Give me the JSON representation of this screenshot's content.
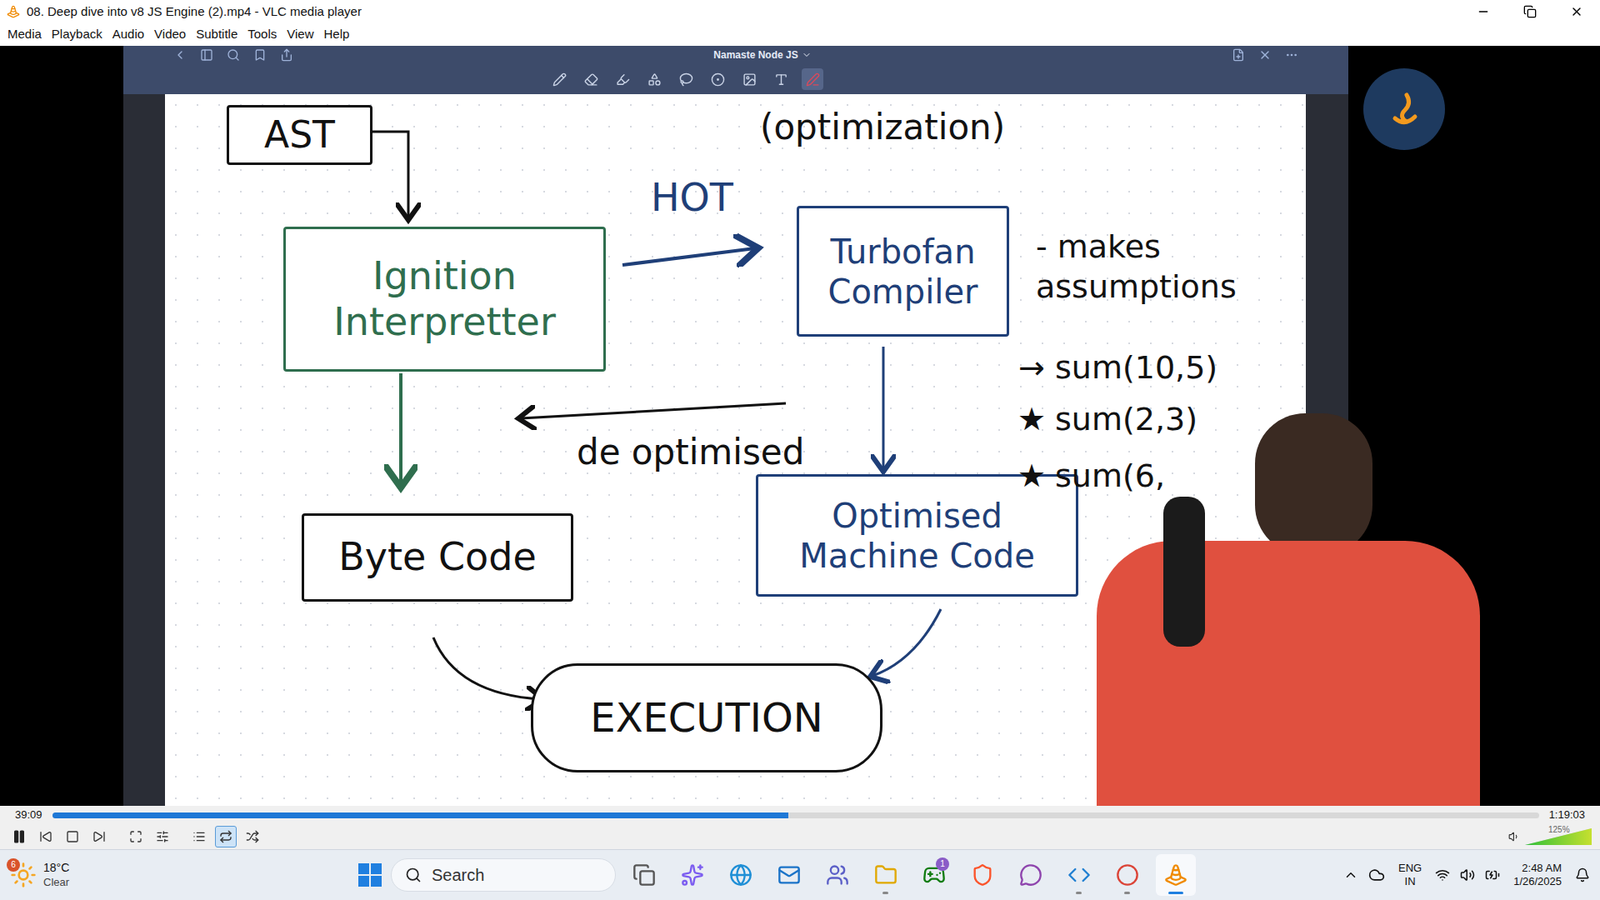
{
  "window": {
    "title": "08. Deep dive into v8 JS Engine (2).mp4 - VLC media player"
  },
  "menu": [
    "Media",
    "Playback",
    "Audio",
    "Video",
    "Subtitle",
    "Tools",
    "View",
    "Help"
  ],
  "video": {
    "notes_app": {
      "title": "Namaste Node JS",
      "tools": [
        {
          "selected": false
        },
        {
          "selected": false
        },
        {
          "selected": false
        },
        {
          "selected": false
        },
        {
          "selected": false
        },
        {
          "selected": false
        },
        {
          "selected": false
        },
        {
          "selected": false
        },
        {
          "selected": true
        }
      ]
    },
    "diagram": {
      "nodes": [
        {
          "lines": [
            "AST"
          ],
          "color": "#111111",
          "kind": "box"
        },
        {
          "lines": [
            "Ignition",
            "Interpretter"
          ],
          "color": "#2f6e4e",
          "kind": "box"
        },
        {
          "lines": [
            "Turbofan",
            "Compiler"
          ],
          "color": "#1f3f78",
          "kind": "box"
        },
        {
          "lines": [
            "Byte Code"
          ],
          "color": "#111111",
          "kind": "box"
        },
        {
          "lines": [
            "Optimised",
            "Machine Code"
          ],
          "color": "#1f3f78",
          "kind": "box"
        },
        {
          "lines": [
            "EXECUTION"
          ],
          "color": "#111111",
          "kind": "cloud"
        }
      ],
      "labels": [
        {
          "text": "HOT",
          "color": "#1f3f78"
        },
        {
          "text": "(optimization)",
          "color": "#111111"
        },
        {
          "text": "de optimised",
          "color": "#111111"
        },
        {
          "text": "- makes assumptions",
          "color": "#111111"
        }
      ],
      "examples": [
        {
          "marker": "→",
          "text": "sum(10,5)"
        },
        {
          "marker": "★",
          "text": "sum(2,3)"
        },
        {
          "marker": "★",
          "text": "sum(6,"
        }
      ]
    }
  },
  "player": {
    "elapsed": "39:09",
    "total": "1:19:03",
    "level": 0.495,
    "playing": true,
    "buttons": [
      {
        "selected": false
      },
      {
        "selected": false
      },
      {
        "selected": false
      },
      {
        "selected": false
      },
      {
        "selected": false
      },
      {
        "selected": false
      },
      {
        "selected": true
      },
      {
        "selected": false
      }
    ]
  },
  "volume": {
    "reading": "125%",
    "level": 1
  },
  "taskbar": {
    "weather": {
      "temp": "18°C",
      "condition": "Clear",
      "badge": "6"
    },
    "search": {
      "placeholder": "Search"
    },
    "apps": [
      {
        "running": false,
        "active": false
      },
      {
        "running": false,
        "active": false
      },
      {
        "running": false,
        "active": false
      },
      {
        "running": false,
        "active": false
      },
      {
        "running": false,
        "active": false
      },
      {
        "running": true,
        "active": false
      },
      {
        "running": false,
        "active": false,
        "badge": "1"
      },
      {
        "running": false,
        "active": false
      },
      {
        "running": false,
        "active": false
      },
      {
        "running": true,
        "active": false
      },
      {
        "running": true,
        "active": false
      },
      {
        "running": true,
        "active": true
      }
    ],
    "tray": {
      "lang": "ENG",
      "region": "IN",
      "time": "2:48 AM",
      "date": "1/26/2025"
    }
  }
}
